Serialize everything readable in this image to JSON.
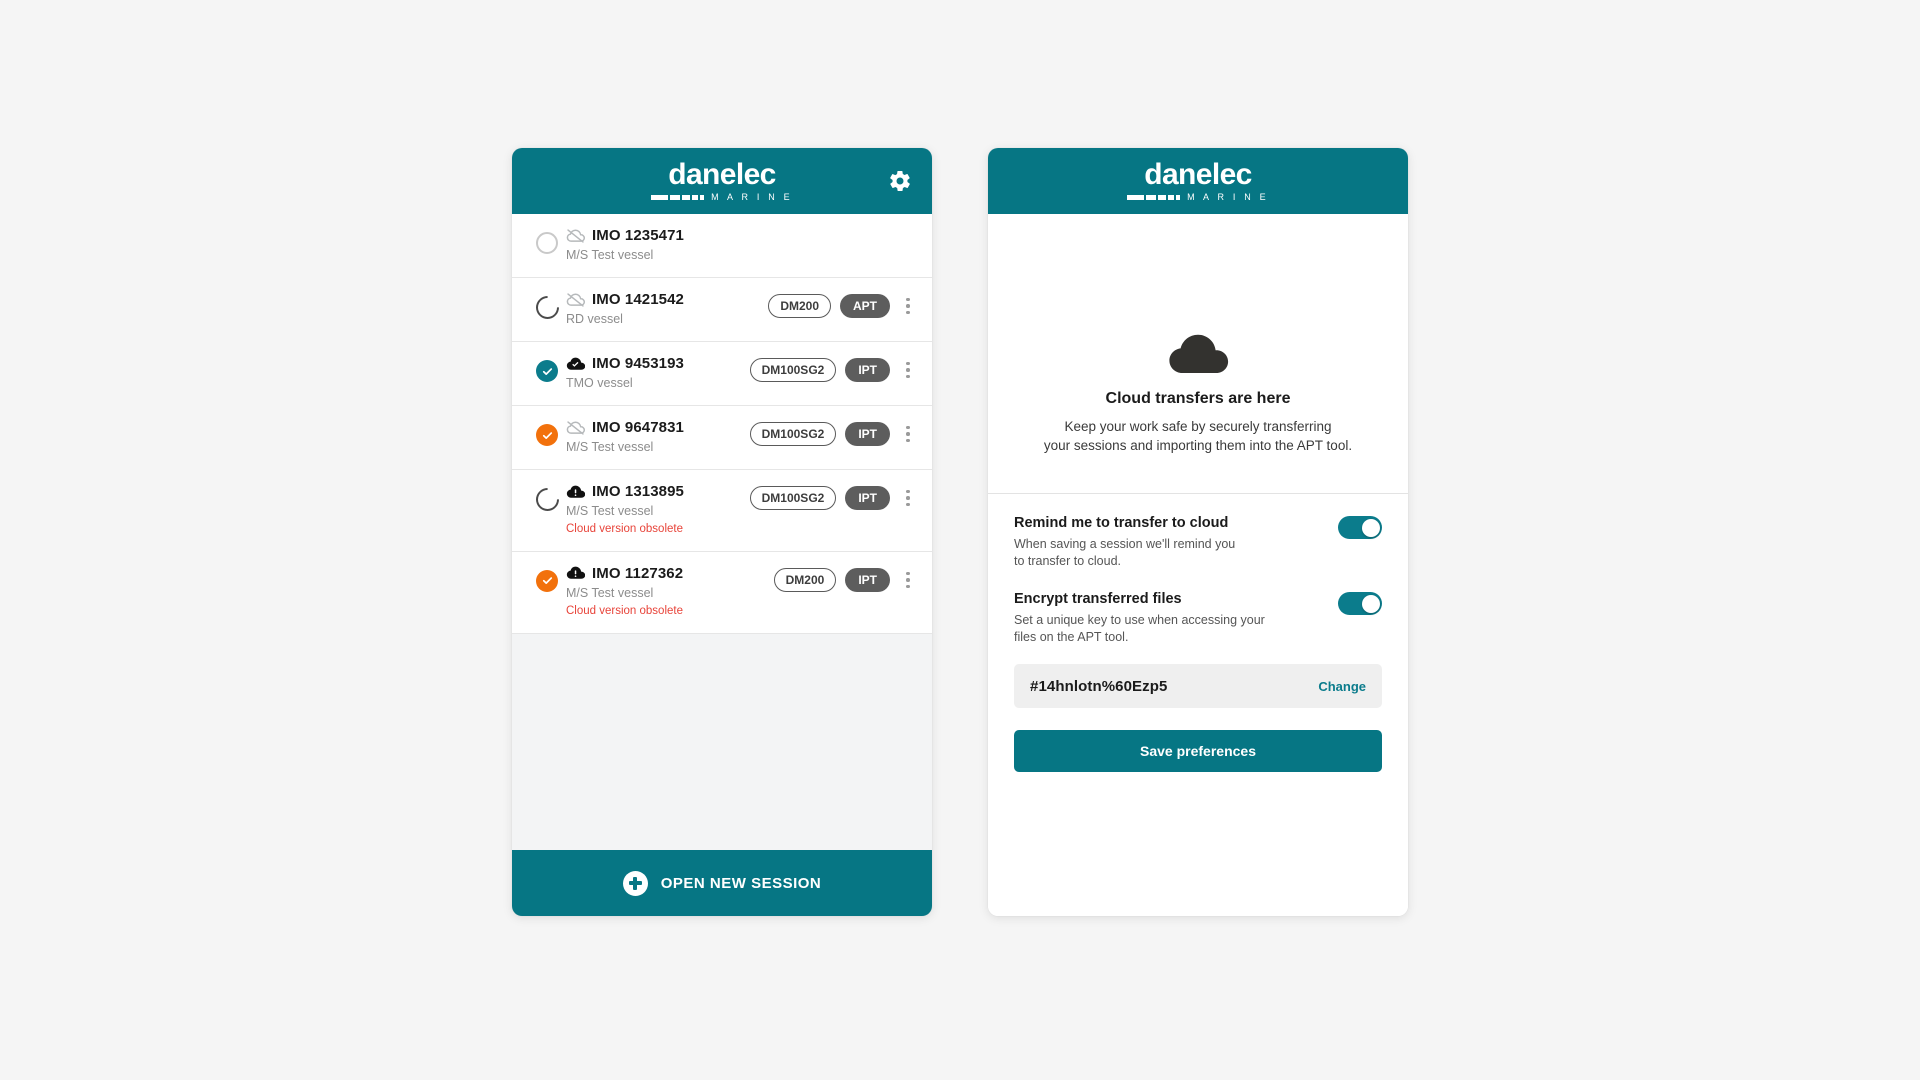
{
  "brand": {
    "logo_word": "danelec",
    "logo_sub": "M A R I N E",
    "teal": "#067684",
    "accent_orange": "#f2710c",
    "warn_red": "#e8443a"
  },
  "sessions_panel": {
    "header": {
      "settings_icon": "gear-icon"
    },
    "rows": [
      {
        "status": "idle",
        "cloud_icon": "cloud-offline-icon",
        "imo": "IMO 1235471",
        "vessel": "M/S Test vessel",
        "warning": "",
        "tags": [],
        "has_menu": false
      },
      {
        "status": "loading",
        "cloud_icon": "cloud-offline-icon",
        "imo": "IMO 1421542",
        "vessel": "RD vessel",
        "warning": "",
        "tags": [
          {
            "label": "DM200",
            "style": "outline"
          },
          {
            "label": "APT",
            "style": "solid"
          }
        ],
        "has_menu": true
      },
      {
        "status": "done-teal",
        "cloud_icon": "cloud-done-icon",
        "imo": "IMO 9453193",
        "vessel": "TMO vessel",
        "warning": "",
        "tags": [
          {
            "label": "DM100SG2",
            "style": "outline"
          },
          {
            "label": "IPT",
            "style": "solid"
          }
        ],
        "has_menu": true
      },
      {
        "status": "done-orange",
        "cloud_icon": "cloud-offline-icon",
        "imo": "IMO 9647831",
        "vessel": "M/S Test vessel",
        "warning": "",
        "tags": [
          {
            "label": "DM100SG2",
            "style": "outline"
          },
          {
            "label": "IPT",
            "style": "solid"
          }
        ],
        "has_menu": true
      },
      {
        "status": "loading",
        "cloud_icon": "cloud-alert-icon",
        "imo": "IMO 1313895",
        "vessel": "M/S Test vessel",
        "warning": "Cloud version obsolete",
        "tags": [
          {
            "label": "DM100SG2",
            "style": "outline"
          },
          {
            "label": "IPT",
            "style": "solid"
          }
        ],
        "has_menu": true
      },
      {
        "status": "done-orange",
        "cloud_icon": "cloud-alert-icon",
        "imo": "IMO 1127362",
        "vessel": "M/S Test vessel",
        "warning": "Cloud version obsolete",
        "tags": [
          {
            "label": "DM200",
            "style": "outline"
          },
          {
            "label": "IPT",
            "style": "solid"
          }
        ],
        "has_menu": true
      }
    ],
    "cta": {
      "label": "OPEN NEW SESSION",
      "icon": "plus-circle-icon"
    }
  },
  "prefs_panel": {
    "hero": {
      "icon": "cloud-icon",
      "title": "Cloud transfers are here",
      "line1": "Keep your work safe by securely transferring",
      "line2": "your sessions and importing them into the APT tool."
    },
    "items": [
      {
        "title": "Remind me to transfer to cloud",
        "desc_line1": "When saving a session we'll remind you",
        "desc_line2": "to transfer to cloud.",
        "toggle_on": true
      },
      {
        "title": "Encrypt transferred files",
        "desc_line1": "Set a unique key to use when accessing your",
        "desc_line2": "files on the APT tool.",
        "toggle_on": true
      }
    ],
    "key_field": {
      "value": "#14hnlotn%60Ezp5",
      "change_label": "Change"
    },
    "save_label": "Save preferences"
  }
}
